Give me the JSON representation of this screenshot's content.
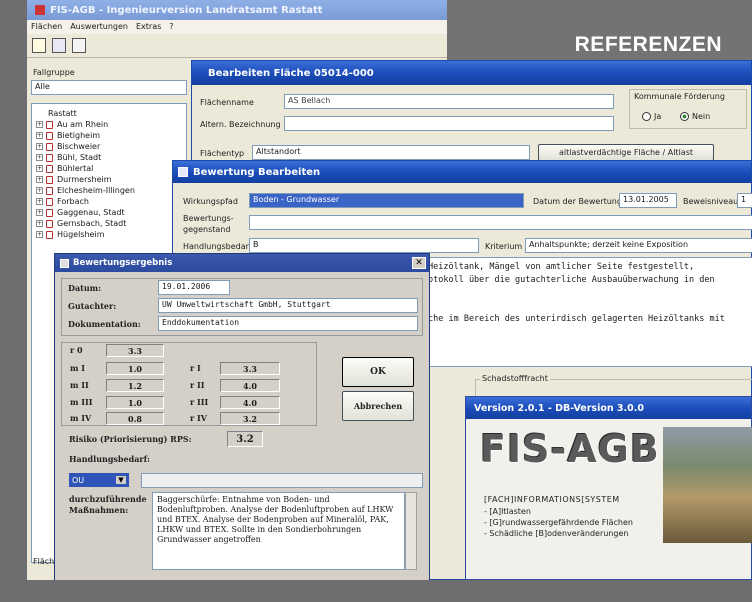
{
  "banner": {
    "title": "REFERENZEN"
  },
  "main_window": {
    "title": "FIS-AGB - Ingenieurversion Landratsamt Rastatt",
    "menu": [
      "Flächen",
      "Auswertungen",
      "Extras",
      "?"
    ]
  },
  "left_panel": {
    "fallgruppe_label": "Fallgruppe",
    "fallgruppe_value": "Alle",
    "tree_root": "Rastatt",
    "tree_items": [
      "Au am Rhein",
      "Bietigheim",
      "Bischweier",
      "Bühl, Stadt",
      "Bühlertal",
      "Durmersheim",
      "Elchesheim-Illingen",
      "Forbach",
      "Gaggenau, Stadt",
      "Gernsbach, Stadt",
      "Hügelsheim"
    ],
    "bottom_label": "Fläch"
  },
  "bearbeiten": {
    "title": "Bearbeiten Fläche 05014-000",
    "flaechenname_label": "Flächenname",
    "flaechenname_value": "AS Bellach",
    "altern_label": "Altern. Bezeichnung",
    "flaechentyp_label": "Flächentyp",
    "flaechentyp_value": "Altstandort",
    "altlast_button": "altlastverdächtige Fläche / Altlast",
    "foerderung_label": "Kommunale Förderung",
    "ja_label": "Ja",
    "nein_label": "Nein"
  },
  "bewertung": {
    "title": "Bewertung Bearbeiten",
    "wirkungspfad_label": "Wirkungspfad",
    "wirkungspfad_value": "Boden - Grundwasser",
    "datum_label": "Datum der Bewertung",
    "datum_value": "13.01.2005",
    "beweisniveau_label": "Beweisniveau",
    "beweisniveau_value": "1",
    "gegenstand_label": "Bewertungs-\ngegenstand",
    "handlungsbedarf_label": "Handlungsbedarf",
    "handlungsbedarf_value": "B",
    "kriterium_label": "Kriterium",
    "kriterium_value": "Anhaltspunkte; derzeit keine Exposition",
    "text_line1": "Heizöltank, Mängel von amtlicher Seite festgestellt,",
    "text_line2": "otokoll über die gutachterliche Ausbauüberwachung in den",
    "text_line3": "che im Bereich des unterirdisch gelagerten Heizöltanks mit",
    "schadstoff_label": "Schadstofffracht"
  },
  "ergebnis": {
    "title": "Bewertungsergebnis",
    "datum_label": "Datum:",
    "datum_value": "19.01.2006",
    "gutachter_label": "Gutachter:",
    "gutachter_value": "UW Umweltwirtschaft GmbH, Stuttgart",
    "doku_label": "Dokumentation:",
    "doku_value": "Enddokumentation",
    "r0_label": "r 0",
    "r0_value": "3.3",
    "mI_label": "m I",
    "mI_value": "1.0",
    "mII_label": "m II",
    "mII_value": "1.2",
    "mIII_label": "m III",
    "mIII_value": "1.0",
    "mIV_label": "m IV",
    "mIV_value": "0.8",
    "rI_label": "r I",
    "rI_value": "3.3",
    "rII_label": "r II",
    "rII_value": "4.0",
    "rIII_label": "r III",
    "rIII_value": "4.0",
    "rIV_label": "r IV",
    "rIV_value": "3.2",
    "ok_label": "OK",
    "abbrechen_label": "Abbrechen",
    "risiko_label": "Risiko (Priorisierung) RPS:",
    "risiko_value": "3.2",
    "handlungsbedarf_label": "Handlungsbedarf:",
    "select_value": "OU",
    "massnahmen_label": "durchzuführende\nMaßnahmen:",
    "massnahmen_text": "Baggerschürfe: Entnahme von Boden- und Bodenluftproben. Analyse der Bodenluftproben auf LHKW und BTEX. Analyse der Bodenproben auf Mineralöl, PAK, LHKW und BTEX. Sollte in den Sondierbohrungen Grundwasser angetroffen"
  },
  "splash": {
    "title": "Version 2.0.1 - DB-Version 3.0.0",
    "logo": "FIS-AGB",
    "subtitle": "[FACH]INFORMATIONS[SYSTEM",
    "items": [
      "- [A]ltlasten",
      "- [G]rundwassergefährdende Flächen",
      "- Schädliche [B]odenveränderungen"
    ]
  },
  "colors": {
    "xp_blue": "#1a4bb8",
    "dialog_blue": "#2c4a9e",
    "panel": "#d4d0c8",
    "page_bg": "#6e6e70"
  }
}
